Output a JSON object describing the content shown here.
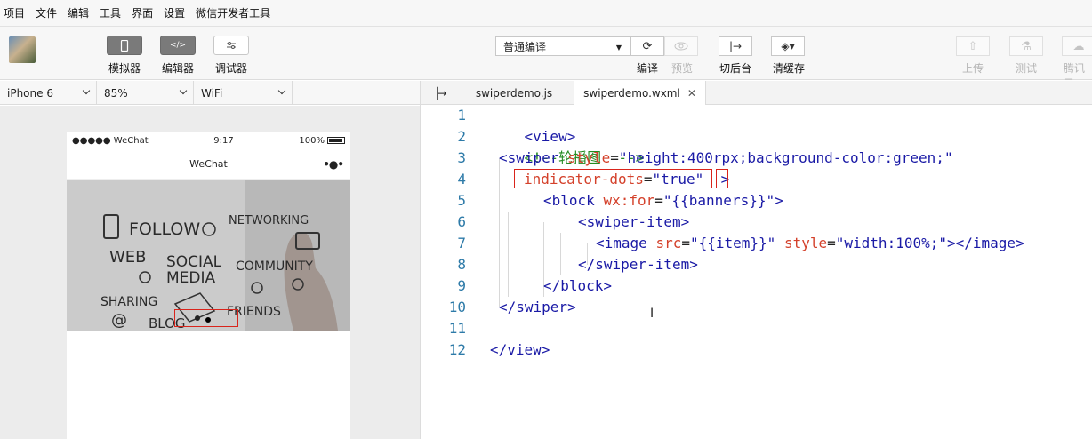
{
  "menubar": [
    "项目",
    "文件",
    "编辑",
    "工具",
    "界面",
    "设置",
    "微信开发者工具"
  ],
  "toolbar": {
    "simulator_label": "模拟器",
    "editor_label": "编辑器",
    "debugger_label": "调试器",
    "compile_mode": "普通编译",
    "compile_label": "编译",
    "preview_label": "预览",
    "background_label": "切后台",
    "clear_cache_label": "清缓存",
    "upload_label": "上传",
    "test_label": "测试",
    "tencent_cloud_label": "腾讯云"
  },
  "device": {
    "model": "iPhone 6",
    "zoom": "85%",
    "network": "WiFi"
  },
  "phone": {
    "carrier": "●●●●● WeChat",
    "time": "9:17",
    "battery": "100%",
    "title": "WeChat",
    "more": "•●•"
  },
  "swiper_words": [
    "FOLLOW",
    "NETWORKING",
    "WEB",
    "SOCIAL",
    "MEDIA",
    "COMMUNITY",
    "SHARING",
    "@",
    "BLOG",
    "FRIENDS"
  ],
  "tabs": [
    {
      "label": "swiperdemo.js"
    },
    {
      "label": "swiperdemo.wxml",
      "close": "✕"
    }
  ],
  "code_lines": [
    {
      "n": "1"
    },
    {
      "n": "2"
    },
    {
      "n": "3"
    },
    {
      "n": "4"
    },
    {
      "n": "5"
    },
    {
      "n": "6"
    },
    {
      "n": "7"
    },
    {
      "n": "8"
    },
    {
      "n": "9"
    },
    {
      "n": "10"
    },
    {
      "n": "11"
    },
    {
      "n": "12"
    }
  ],
  "code": {
    "l1_tag": "<view>",
    "l2_comment": "<!--轮播图  -->",
    "l3_open": "<swiper",
    "l3_attr": "style",
    "l3_eq": "=",
    "l3_val": "\"height:400rpx;background-color:green;\"",
    "l4_attr": "indicator-dots",
    "l4_eq": "=",
    "l4_val": "\"true\"",
    "l4_close": ">",
    "l5_open": "<block",
    "l5_attr": "wx:for",
    "l5_eq": "=",
    "l5_val": "\"{{banners}}\"",
    "l5_close": ">",
    "l6_tag": "<swiper-item>",
    "l7_open": "<image",
    "l7_attr1": "src",
    "l7_eq1": "=",
    "l7_val1": "\"{{item}}\"",
    "l7_attr2": "style",
    "l7_eq2": "=",
    "l7_val2": "\"width:100%;\"",
    "l7_close": "></image>",
    "l8_tag": "</swiper-item>",
    "l9_tag": "</block>",
    "l10_tag": "</swiper>",
    "l12_tag": "</view>"
  },
  "colors": {
    "tag": "#1a1aa6",
    "attribute": "#d4412b",
    "comment": "#238b22",
    "line_number": "#2d7aa8",
    "highlight_box": "#d9241b"
  }
}
